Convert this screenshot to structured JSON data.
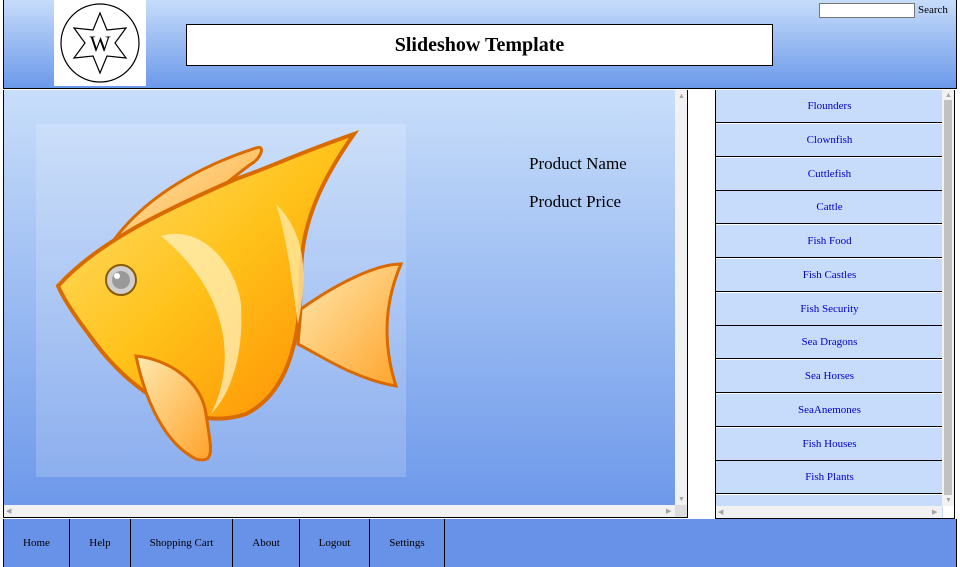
{
  "header": {
    "logo_letter": "W",
    "title": "Slideshow Template",
    "search_label": "Search",
    "search_value": ""
  },
  "product": {
    "image_icon": "goldfish-icon",
    "name": "Product Name",
    "price": "Product Price"
  },
  "sidebar": {
    "items": [
      {
        "label": "Flounders"
      },
      {
        "label": "Clownfish"
      },
      {
        "label": "Cuttlefish"
      },
      {
        "label": "Cattle"
      },
      {
        "label": "Fish Food"
      },
      {
        "label": "Fish Castles"
      },
      {
        "label": "Fish Security"
      },
      {
        "label": "Sea Dragons"
      },
      {
        "label": "Sea Horses"
      },
      {
        "label": "SeaAnemones"
      },
      {
        "label": "Fish Houses"
      },
      {
        "label": "Fish Plants"
      }
    ]
  },
  "nav": {
    "items": [
      {
        "label": "Home"
      },
      {
        "label": "Help"
      },
      {
        "label": "Shopping Cart"
      },
      {
        "label": "About"
      },
      {
        "label": "Logout"
      },
      {
        "label": "Settings"
      }
    ]
  },
  "colors": {
    "header_top": "#c6dcfa",
    "header_bottom": "#6b99ea",
    "footer": "#6792e8",
    "link": "#0000cc"
  }
}
